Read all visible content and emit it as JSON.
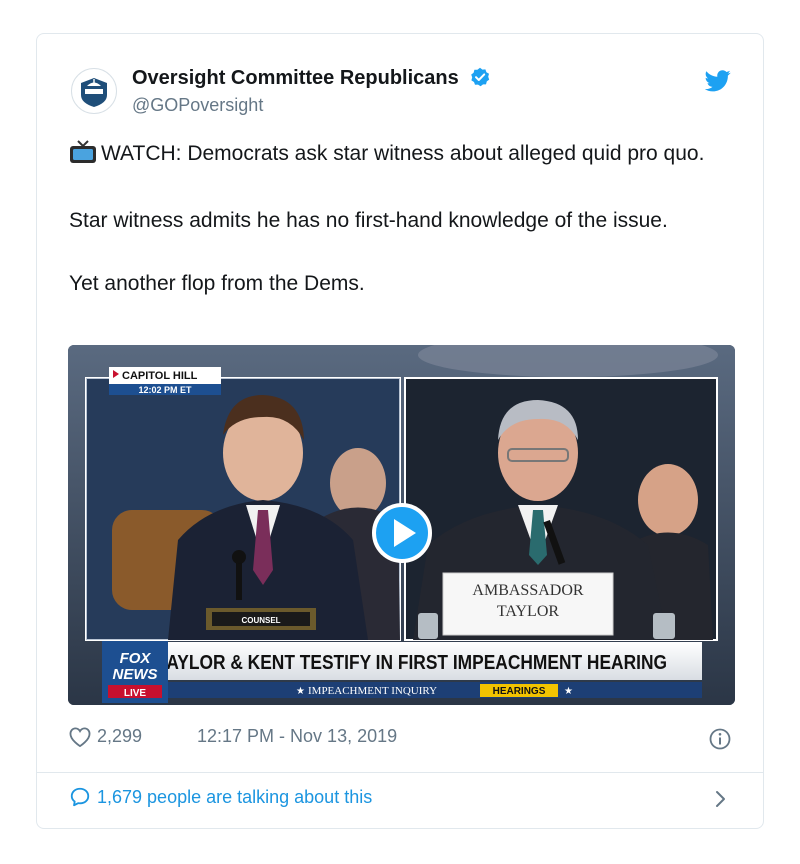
{
  "account": {
    "name": "Oversight Committee Republicans",
    "handle": "@GOPoversight"
  },
  "tweet": {
    "line1": "WATCH: Democrats ask star witness about alleged quid pro quo.",
    "line2": "Star witness admits he has no first-hand knowledge of the issue.",
    "line3": "Yet another flop from the Dems."
  },
  "media": {
    "location_tag": "CAPITOL HILL",
    "clock": "12:02 PM ET",
    "counsel_label": "COUNSEL",
    "nameplate_line1": "AMBASSADOR",
    "nameplate_line2": "TAYLOR",
    "network_line1": "FOX",
    "network_line2": "NEWS",
    "network_line3": "LIVE",
    "headline": "TAYLOR & KENT TESTIFY IN FIRST IMPEACHMENT HEARING",
    "subline": "IMPEACHMENT INQUIRY",
    "subline_badge": "HEARINGS"
  },
  "footer": {
    "likes": "2,299",
    "timestamp": "12:17 PM - Nov 13, 2019",
    "talking": "1,679 people are talking about this"
  },
  "icons": {
    "verified": "verified-badge-icon",
    "bird": "twitter-bird-icon",
    "heart": "heart-icon",
    "info": "info-icon",
    "comment": "comment-icon",
    "play": "play-icon",
    "tv": "tv-emoji-icon",
    "chevron": "chevron-right-icon"
  },
  "colors": {
    "brand_blue": "#1da1f2",
    "link_blue": "#1b95e0",
    "muted": "#657786",
    "text": "#14171a"
  }
}
